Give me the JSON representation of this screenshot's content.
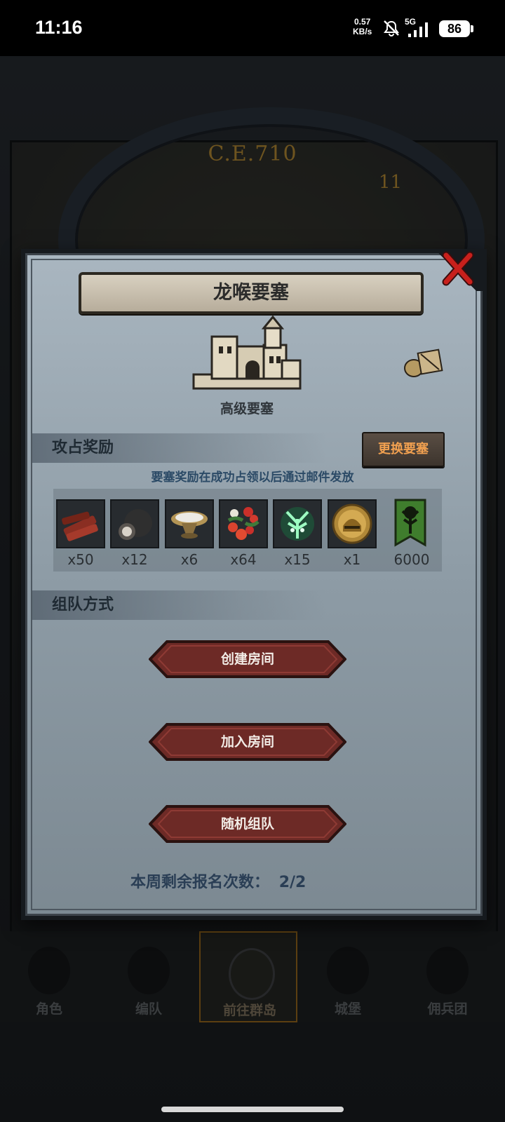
{
  "status_bar": {
    "time": "11:16",
    "net_speed_value": "0.57",
    "net_speed_unit": "KB/s",
    "network": "5G",
    "battery": "86"
  },
  "background": {
    "era": "C.E.710",
    "hour": "11"
  },
  "dialog": {
    "title": "龙喉要塞",
    "castle_name": "高级要塞",
    "reward_section": "攻占奖励",
    "swap_button": "更换要塞",
    "reward_note": "要塞奖励在成功占领以后通过邮件发放",
    "rewards": [
      {
        "icon": "wood-logs-icon",
        "count": "x50"
      },
      {
        "icon": "truffle-icon",
        "count": "x12"
      },
      {
        "icon": "salt-bowl-icon",
        "count": "x6"
      },
      {
        "icon": "berries-icon",
        "count": "x64"
      },
      {
        "icon": "green-spirit-icon",
        "count": "x15"
      },
      {
        "icon": "helmet-medal-icon",
        "count": "x1"
      },
      {
        "icon": "green-banner-icon",
        "count": "6000"
      }
    ],
    "team_section": "组队方式",
    "buttons": {
      "create_room": "创建房间",
      "join_room": "加入房间",
      "random_team": "随机组队"
    },
    "signup_label": "本周剩余报名次数：",
    "signup_value": "2/2"
  },
  "bottom_nav": [
    {
      "label": "角色",
      "icon": "character-icon"
    },
    {
      "label": "编队",
      "icon": "formation-icon"
    },
    {
      "label": "前往群岛",
      "icon": "archipelago-icon",
      "active": true
    },
    {
      "label": "城堡",
      "icon": "castle-icon"
    },
    {
      "label": "佣兵团",
      "icon": "mercenary-icon"
    }
  ],
  "colors": {
    "button_red": "#6d2a26",
    "accent_orange": "#f0a050",
    "dialog_bg": "#9aa7b1"
  }
}
